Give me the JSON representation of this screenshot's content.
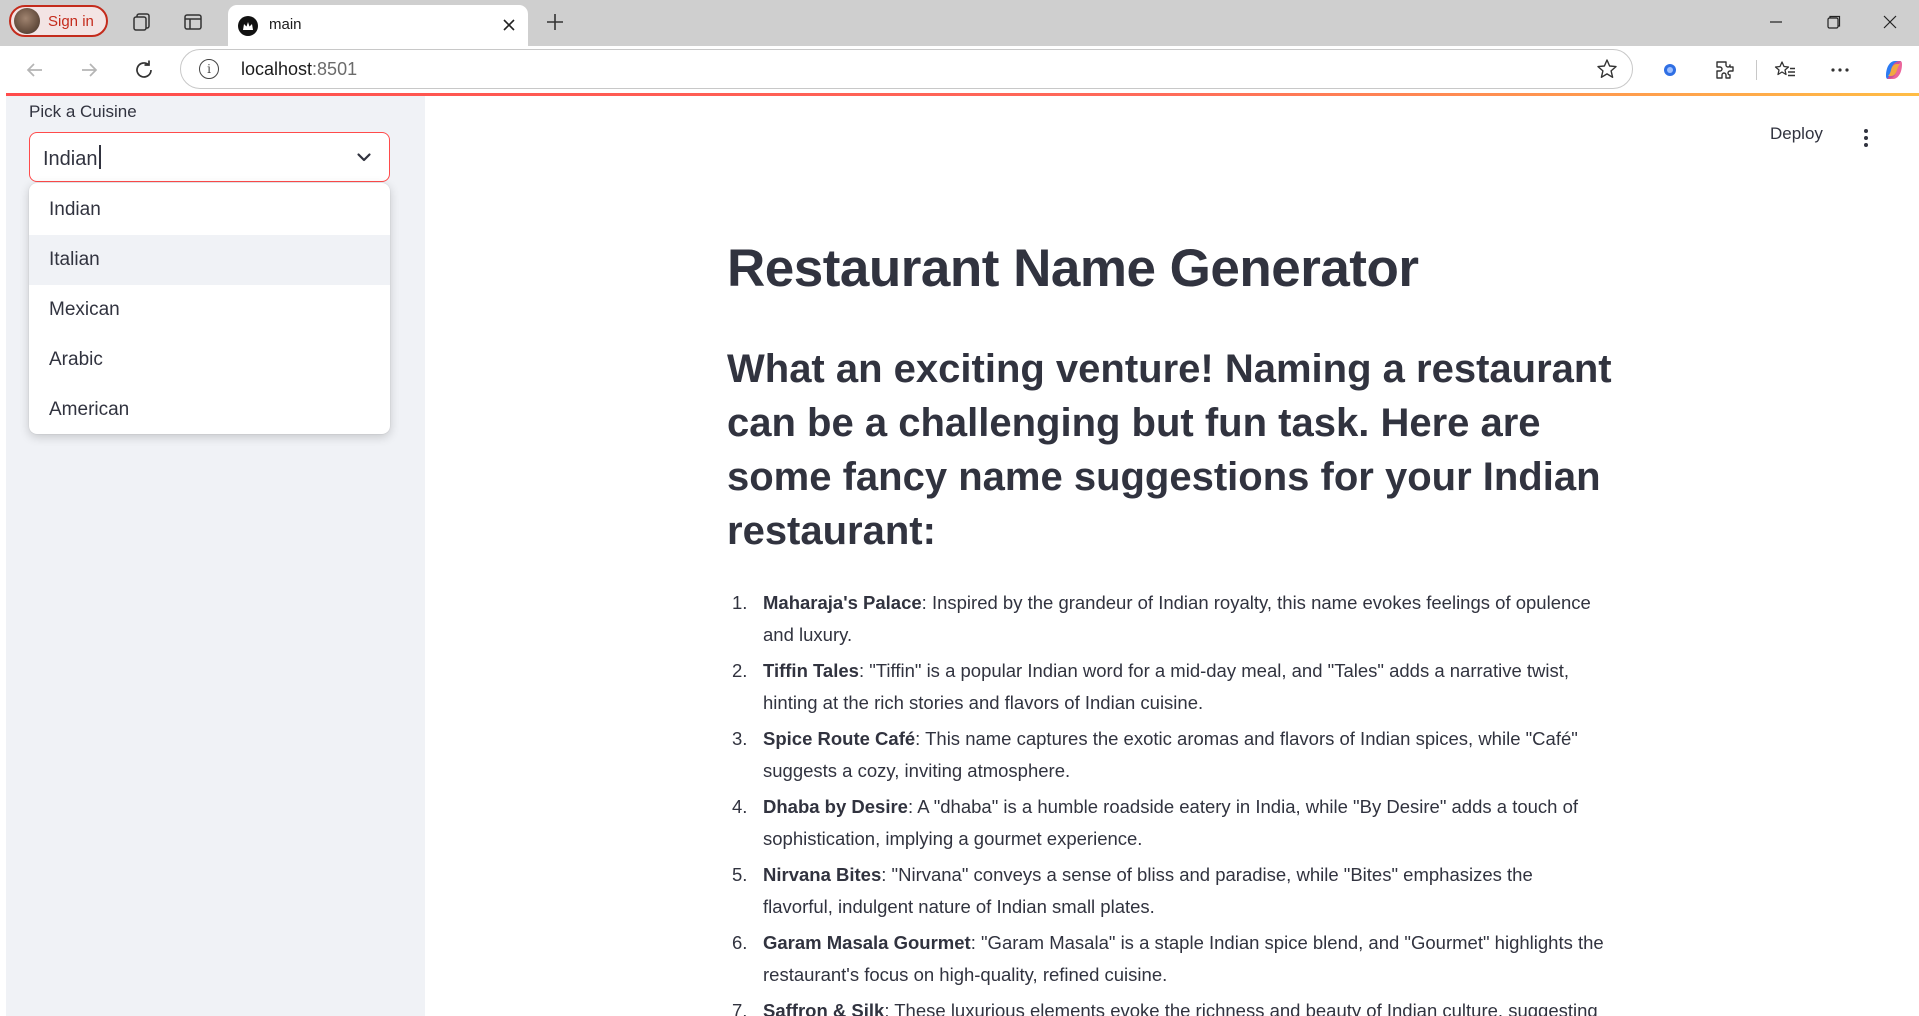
{
  "browser": {
    "signin_label": "Sign in",
    "tab_title": "main",
    "url_host": "localhost",
    "url_port": ":8501"
  },
  "sidebar": {
    "select_label": "Pick a Cuisine",
    "select_value": "Indian",
    "options": [
      "Indian",
      "Italian",
      "Mexican",
      "Arabic",
      "American"
    ],
    "hovered_option": "Italian"
  },
  "header": {
    "deploy_label": "Deploy"
  },
  "main": {
    "title": "Restaurant Name Generator",
    "intro": "What an exciting venture! Naming a restaurant can be a challenging but fun task. Here are some fancy name suggestions for your Indian restaurant:",
    "items": [
      {
        "num": "1.",
        "name": "Maharaja's Palace",
        "desc": ": Inspired by the grandeur of Indian royalty, this name evokes feelings of opulence and luxury."
      },
      {
        "num": "2.",
        "name": "Tiffin Tales",
        "desc": ": \"Tiffin\" is a popular Indian word for a mid-day meal, and \"Tales\" adds a narrative twist, hinting at the rich stories and flavors of Indian cuisine."
      },
      {
        "num": "3.",
        "name": "Spice Route Café",
        "desc": ": This name captures the exotic aromas and flavors of Indian spices, while \"Café\" suggests a cozy, inviting atmosphere."
      },
      {
        "num": "4.",
        "name": "Dhaba by Desire",
        "desc": ": A \"dhaba\" is a humble roadside eatery in India, while \"By Desire\" adds a touch of sophistication, implying a gourmet experience."
      },
      {
        "num": "5.",
        "name": "Nirvana Bites",
        "desc": ": \"Nirvana\" conveys a sense of bliss and paradise, while \"Bites\" emphasizes the flavorful, indulgent nature of Indian small plates."
      },
      {
        "num": "6.",
        "name": "Garam Masala Gourmet",
        "desc": ": \"Garam Masala\" is a staple Indian spice blend, and \"Gourmet\" highlights the restaurant's focus on high-quality, refined cuisine."
      },
      {
        "num": "7.",
        "name": "Saffron & Silk",
        "desc": ": These luxurious elements evoke the richness and beauty of Indian culture, suggesting"
      }
    ]
  },
  "colors": {
    "accent": "#ff4b4b",
    "sidebar_bg": "#f0f2f6",
    "text": "#31333f"
  }
}
